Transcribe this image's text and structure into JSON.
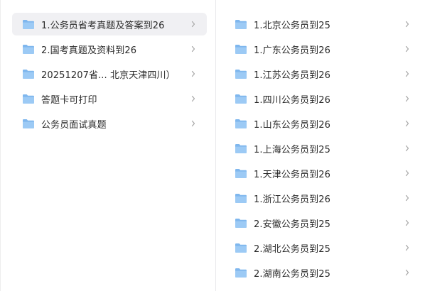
{
  "left_pane": {
    "items": [
      {
        "label": "1.公务员省考真题及答案到26",
        "selected": true
      },
      {
        "label": "2.国考真题及资料到26",
        "selected": false
      },
      {
        "label": "20251207省...  北京天津四川）",
        "selected": false
      },
      {
        "label": "答题卡可打印",
        "selected": false
      },
      {
        "label": "公务员面试真题",
        "selected": false
      }
    ]
  },
  "right_pane": {
    "items": [
      {
        "label": "1.北京公务员到25"
      },
      {
        "label": "1.广东公务员到26"
      },
      {
        "label": "1.江苏公务员到26"
      },
      {
        "label": "1.四川公务员到26"
      },
      {
        "label": "1.山东公务员到26"
      },
      {
        "label": "1.上海公务员到25"
      },
      {
        "label": "1.天津公务员到26"
      },
      {
        "label": "1.浙江公务员到26"
      },
      {
        "label": "2.安徽公务员到25"
      },
      {
        "label": "2.湖北公务员到25"
      },
      {
        "label": "2.湖南公务员到25"
      }
    ]
  },
  "icons": {
    "folder": "folder-icon",
    "chevron": "chevron-right-icon"
  },
  "colors": {
    "folder": "#7fb7ee",
    "selected_bg": "#f0f0f3",
    "text": "#2a2a2a",
    "chevron": "#a6a6a6"
  }
}
